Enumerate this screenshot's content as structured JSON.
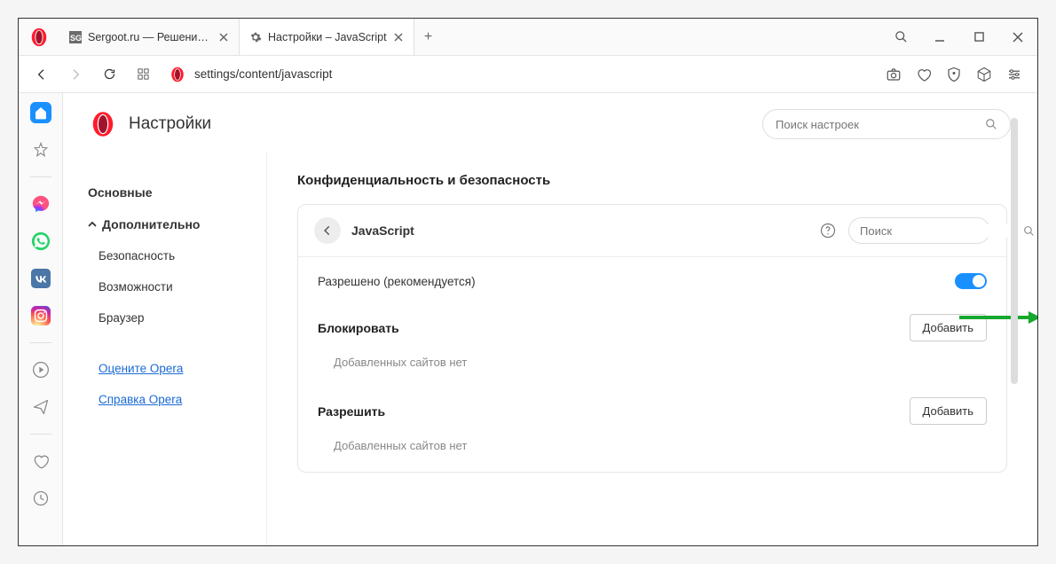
{
  "tabs": [
    {
      "label": "Sergoot.ru — Решение ва..."
    },
    {
      "label": "Настройки – JavaScript"
    }
  ],
  "url": {
    "prefix": "",
    "path": "settings/content/javascript"
  },
  "settings": {
    "title": "Настройки",
    "search_placeholder": "Поиск настроек"
  },
  "sidenav": {
    "main": "Основные",
    "advanced": "Дополнительно",
    "subs": [
      "Безопасность",
      "Возможности",
      "Браузер"
    ],
    "links": [
      "Оцените Opera",
      "Справка Opera"
    ]
  },
  "page": {
    "section": "Конфиденциальность и безопасность",
    "card_title": "JavaScript",
    "card_search_placeholder": "Поиск",
    "allowed_label": "Разрешено (рекомендуется)",
    "block": {
      "title": "Блокировать",
      "add": "Добавить",
      "empty": "Добавленных сайтов нет"
    },
    "allow": {
      "title": "Разрешить",
      "add": "Добавить",
      "empty": "Добавленных сайтов нет"
    }
  }
}
